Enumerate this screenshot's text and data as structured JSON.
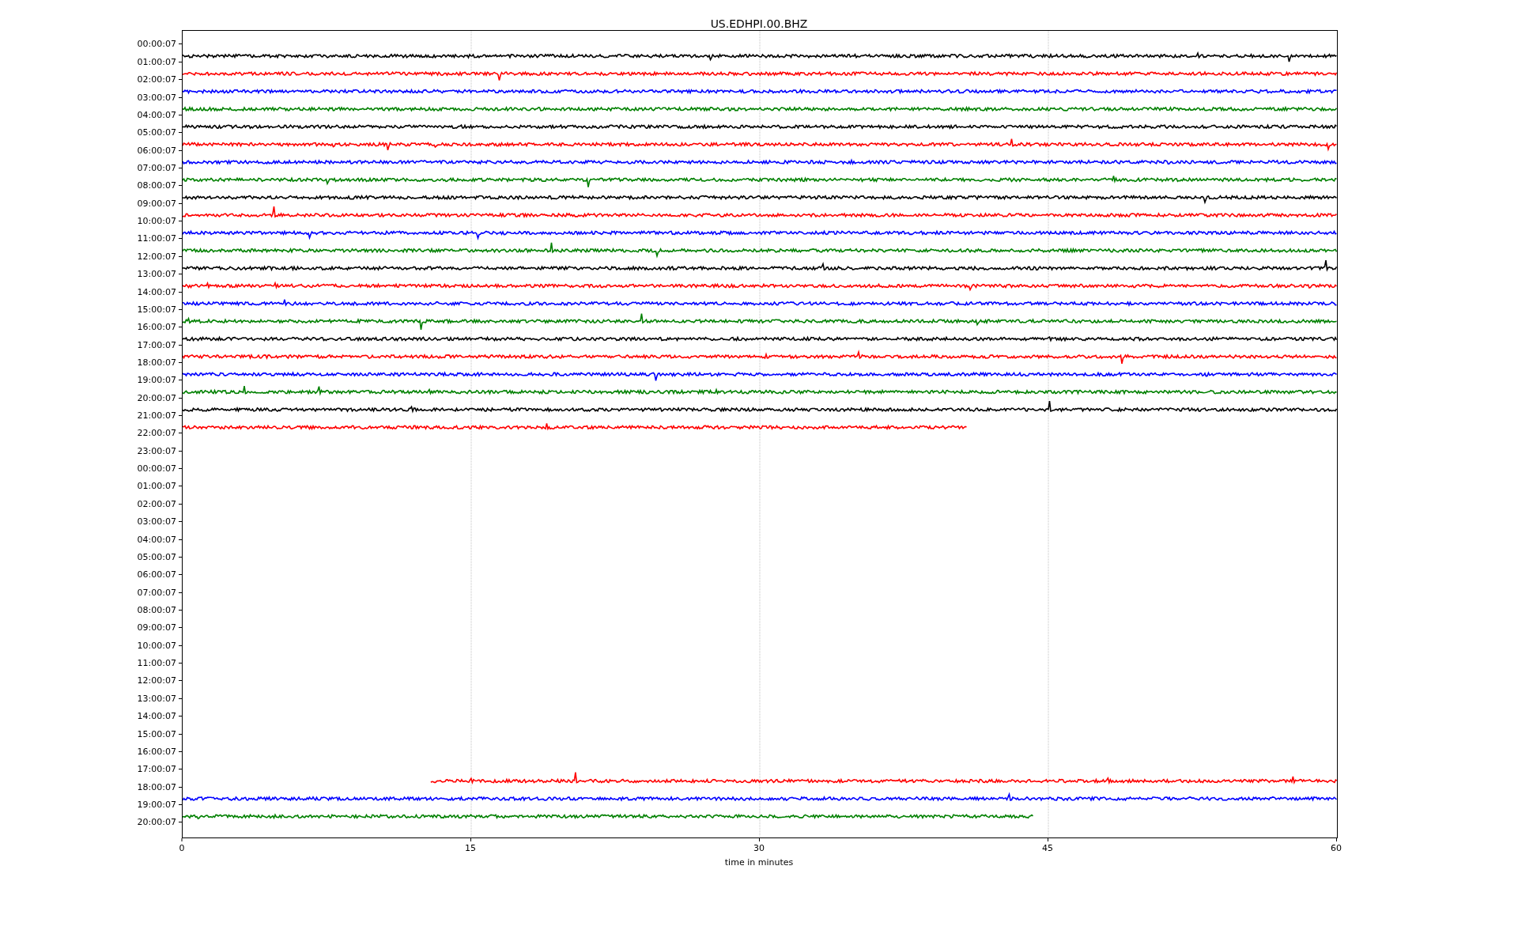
{
  "title": "US.EDHPI.00.BHZ",
  "chart": {
    "xlabel": "time in minutes",
    "xticks": [
      "0",
      "15",
      "30",
      "45",
      "60"
    ],
    "rows": [
      {
        "label": "00:00:07",
        "trace": {
          "color": "#000000",
          "level": 1,
          "kind": "from-start"
        }
      },
      {
        "label": "01:00:07",
        "trace": {
          "color": "#ff0000",
          "level": 1,
          "kind": "from-start"
        }
      },
      {
        "label": "02:00:07",
        "trace": {
          "color": "#0000ff",
          "level": 1,
          "kind": "from-start"
        }
      },
      {
        "label": "03:00:07",
        "trace": {
          "color": "#008000",
          "level": 1,
          "kind": "from-start"
        }
      },
      {
        "label": "04:00:07",
        "trace": {
          "color": "#000000",
          "level": 1,
          "kind": "from-start"
        }
      },
      {
        "label": "05:00:07",
        "trace": {
          "color": "#ff0000",
          "level": 1,
          "kind": "from-start"
        }
      },
      {
        "label": "06:00:07",
        "trace": {
          "color": "#0000ff",
          "level": 1,
          "kind": "from-start"
        }
      },
      {
        "label": "07:00:07",
        "trace": {
          "color": "#008000",
          "level": 1,
          "kind": "from-start"
        }
      },
      {
        "label": "08:00:07",
        "trace": {
          "color": "#000000",
          "level": 1,
          "kind": "from-start"
        }
      },
      {
        "label": "09:00:07",
        "trace": {
          "color": "#ff0000",
          "level": 1,
          "kind": "from-start"
        }
      },
      {
        "label": "10:00:07",
        "trace": {
          "color": "#0000ff",
          "level": 1,
          "kind": "from-start"
        }
      },
      {
        "label": "11:00:07",
        "trace": {
          "color": "#008000",
          "level": 1,
          "kind": "from-start"
        }
      },
      {
        "label": "12:00:07",
        "trace": {
          "color": "#000000",
          "level": 1,
          "kind": "from-start"
        }
      },
      {
        "label": "13:00:07",
        "trace": {
          "color": "#ff0000",
          "level": 1,
          "kind": "from-start"
        }
      },
      {
        "label": "14:00:07",
        "trace": {
          "color": "#0000ff",
          "level": 1,
          "kind": "from-start"
        }
      },
      {
        "label": "15:00:07",
        "trace": {
          "color": "#008000",
          "level": 1,
          "kind": "from-start"
        }
      },
      {
        "label": "16:00:07",
        "trace": {
          "color": "#000000",
          "level": 1,
          "kind": "from-start"
        }
      },
      {
        "label": "17:00:07",
        "trace": {
          "color": "#ff0000",
          "level": 1,
          "kind": "from-start"
        }
      },
      {
        "label": "18:00:07",
        "trace": {
          "color": "#0000ff",
          "level": 1,
          "kind": "from-start"
        }
      },
      {
        "label": "19:00:07",
        "trace": {
          "color": "#008000",
          "level": 1,
          "kind": "from-start"
        }
      },
      {
        "label": "20:00:07",
        "trace": {
          "color": "#000000",
          "level": 1,
          "kind": "from-start"
        }
      },
      {
        "label": "21:00:07",
        "trace": {
          "color": "#ff0000",
          "level": 0.68,
          "kind": "from-start"
        }
      },
      {
        "label": "22:00:07"
      },
      {
        "label": "23:00:07"
      },
      {
        "label": "00:00:07"
      },
      {
        "label": "01:00:07"
      },
      {
        "label": "02:00:07"
      },
      {
        "label": "03:00:07"
      },
      {
        "label": "04:00:07"
      },
      {
        "label": "05:00:07"
      },
      {
        "label": "06:00:07"
      },
      {
        "label": "07:00:07"
      },
      {
        "label": "08:00:07"
      },
      {
        "label": "09:00:07"
      },
      {
        "label": "10:00:07"
      },
      {
        "label": "11:00:07"
      },
      {
        "label": "12:00:07"
      },
      {
        "label": "13:00:07"
      },
      {
        "label": "14:00:07"
      },
      {
        "label": "15:00:07"
      },
      {
        "label": "16:00:07"
      },
      {
        "label": "17:00:07",
        "trace": {
          "color": "#ff0000",
          "level": 0.785,
          "kind": "to-end"
        }
      },
      {
        "label": "18:00:07",
        "trace": {
          "color": "#0000ff",
          "level": 1,
          "kind": "from-start"
        }
      },
      {
        "label": "19:00:07",
        "trace": {
          "color": "#008000",
          "level": 0.737,
          "kind": "from-start"
        }
      },
      {
        "label": "20:00:07"
      }
    ]
  }
}
